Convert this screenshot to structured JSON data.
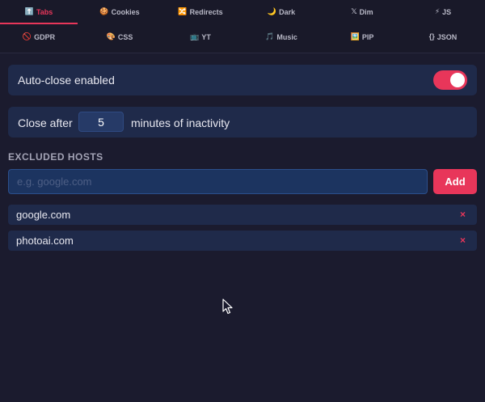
{
  "tabs_row1": [
    {
      "icon": "⬆️",
      "label": "Tabs",
      "active": true
    },
    {
      "icon": "🍪",
      "label": "Cookies"
    },
    {
      "icon": "🔀",
      "label": "Redirects"
    },
    {
      "icon": "🌙",
      "label": "Dark"
    },
    {
      "icon": "𝕏",
      "label": "Dim"
    },
    {
      "icon": "⚡",
      "label": "JS"
    }
  ],
  "tabs_row2": [
    {
      "icon": "🚫",
      "label": "GDPR"
    },
    {
      "icon": "🎨",
      "label": "CSS"
    },
    {
      "icon": "📺",
      "label": "YT"
    },
    {
      "icon": "🎵",
      "label": "Music"
    },
    {
      "icon": "🖼️",
      "label": "PIP"
    },
    {
      "icon": "{}",
      "label": "JSON"
    }
  ],
  "autoclose": {
    "label": "Auto-close enabled",
    "enabled": true
  },
  "close_after": {
    "before": "Close after",
    "value": "5",
    "after": "minutes of inactivity"
  },
  "excluded": {
    "title": "EXCLUDED HOSTS",
    "placeholder": "e.g. google.com",
    "add_label": "Add",
    "hosts": [
      {
        "name": "google.com",
        "remove": "×"
      },
      {
        "name": "photoai.com",
        "remove": "×"
      }
    ]
  },
  "colors": {
    "accent": "#e8365a",
    "background": "#1b1b2e",
    "card": "#1f2a4a"
  }
}
